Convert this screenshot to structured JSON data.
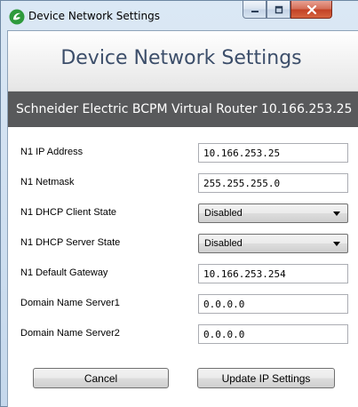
{
  "window": {
    "title": "Device Network Settings",
    "caption_buttons": [
      "minimize-icon",
      "maximize-icon",
      "close-icon"
    ],
    "icon": "app-logo-icon"
  },
  "header": {
    "title": "Device Network Settings"
  },
  "device": {
    "label": "Schneider Electric BCPM Virtual Router  10.166.253.25"
  },
  "form": {
    "rows": [
      {
        "label": "N1 IP Address",
        "type": "text",
        "value": "10.166.253.25"
      },
      {
        "label": "N1 Netmask",
        "type": "text",
        "value": "255.255.255.0"
      },
      {
        "label": "N1 DHCP Client State",
        "type": "select",
        "value": "Disabled"
      },
      {
        "label": "N1 DHCP Server State",
        "type": "select",
        "value": "Disabled"
      },
      {
        "label": "N1 Default Gateway",
        "type": "text",
        "value": "10.166.253.254"
      },
      {
        "label": "Domain Name Server1",
        "type": "text",
        "value": "0.0.0.0"
      },
      {
        "label": "Domain Name Server2",
        "type": "text",
        "value": "0.0.0.0"
      }
    ]
  },
  "buttons": {
    "cancel_label": "Cancel",
    "update_label": "Update IP Settings"
  },
  "colors": {
    "header_text": "#3c4e6a",
    "device_band": "#58595b",
    "close_button": "#c24125",
    "logo_green": "#2e9a3c"
  }
}
